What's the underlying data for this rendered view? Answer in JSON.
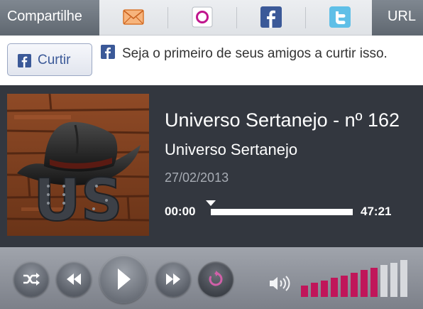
{
  "share": {
    "label": "Compartilhe",
    "url_label": "URL",
    "buttons": [
      {
        "name": "email",
        "icon": "envelope-icon"
      },
      {
        "name": "orkut",
        "icon": "orkut-icon"
      },
      {
        "name": "facebook",
        "icon": "facebook-icon"
      },
      {
        "name": "twitter",
        "icon": "twitter-icon"
      }
    ]
  },
  "like": {
    "button_label": "Curtir",
    "text": "Seja o primeiro de seus amigos a curtir isso."
  },
  "track": {
    "title": "Universo Sertanejo - nº 162",
    "artist": "Universo Sertanejo",
    "date": "27/02/2013",
    "current_time": "00:00",
    "total_time": "47:21",
    "progress": 0,
    "cover_text": "US"
  },
  "controls": {
    "buttons": [
      "shuffle-icon",
      "rewind-icon",
      "play-icon",
      "fast-forward-icon",
      "repeat-icon"
    ],
    "volume_icon": "speaker-icon",
    "volume_level": 8,
    "volume_max": 11
  },
  "colors": {
    "volume_active": "#c0165a",
    "volume_inactive": "#d7d9dd",
    "facebook_blue": "#3b5998",
    "repeat_accent": "#d060a8"
  }
}
